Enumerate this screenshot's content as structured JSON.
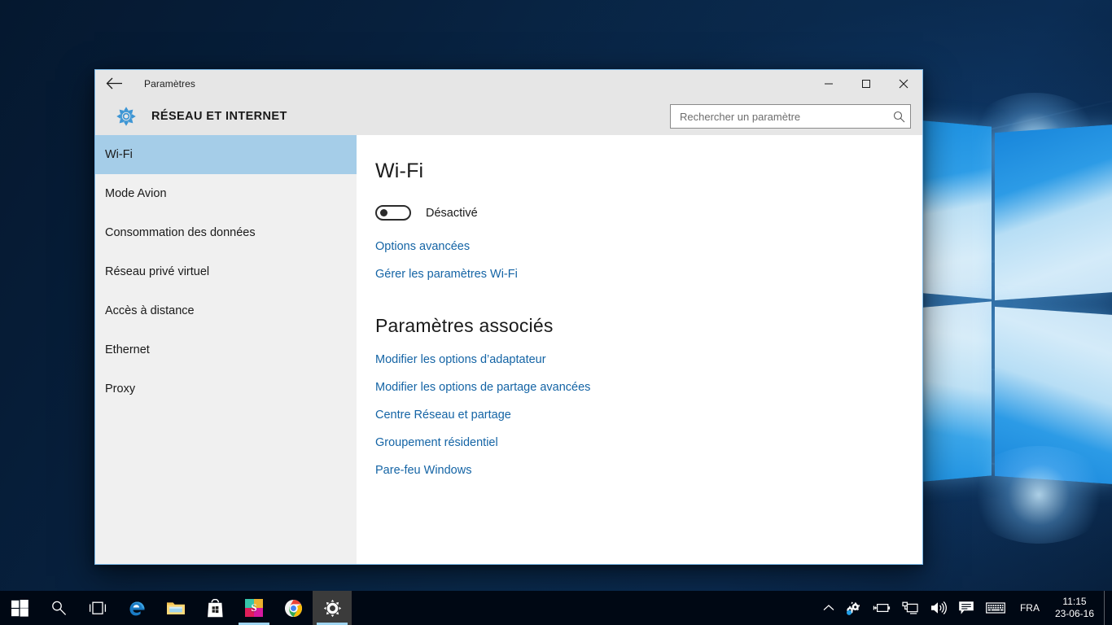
{
  "window": {
    "titlebar": {
      "back_icon": "back-arrow-icon",
      "title": "Paramètres",
      "minimize_icon": "minimize-icon",
      "maximize_icon": "maximize-icon",
      "close_icon": "close-icon"
    },
    "header": {
      "gear_icon": "gear-icon",
      "title": "RÉSEAU ET INTERNET"
    },
    "search": {
      "placeholder": "Rechercher un paramètre",
      "value": "",
      "icon": "search-icon"
    }
  },
  "sidebar": {
    "items": [
      {
        "label": "Wi-Fi",
        "selected": true
      },
      {
        "label": "Mode Avion",
        "selected": false
      },
      {
        "label": "Consommation des données",
        "selected": false
      },
      {
        "label": "Réseau privé virtuel",
        "selected": false
      },
      {
        "label": "Accès à distance",
        "selected": false
      },
      {
        "label": "Ethernet",
        "selected": false
      },
      {
        "label": "Proxy",
        "selected": false
      }
    ]
  },
  "content": {
    "heading": "Wi-Fi",
    "toggle": {
      "state_label": "Désactivé",
      "checked": false
    },
    "wifi_links": [
      "Options avancées",
      "Gérer les paramètres Wi-Fi"
    ],
    "related": {
      "heading": "Paramètres associés",
      "links": [
        "Modifier les options d’adaptateur",
        "Modifier les options de partage avancées",
        "Centre Réseau et partage",
        "Groupement résidentiel",
        "Pare-feu Windows"
      ]
    }
  },
  "taskbar": {
    "buttons": [
      {
        "name": "start-button",
        "icon": "windows-logo-icon",
        "running": false,
        "active": false
      },
      {
        "name": "search-button",
        "icon": "search-icon",
        "running": false,
        "active": false
      },
      {
        "name": "task-view-button",
        "icon": "task-view-icon",
        "running": false,
        "active": false
      },
      {
        "name": "edge-button",
        "icon": "edge-icon",
        "running": false,
        "active": false
      },
      {
        "name": "file-explorer-button",
        "icon": "folder-icon",
        "running": false,
        "active": false
      },
      {
        "name": "store-button",
        "icon": "store-bag-icon",
        "running": false,
        "active": false
      },
      {
        "name": "slack-button",
        "icon": "slack-icon",
        "running": true,
        "active": false,
        "letter": "S"
      },
      {
        "name": "chrome-button",
        "icon": "chrome-icon",
        "running": false,
        "active": false
      },
      {
        "name": "settings-button",
        "icon": "gear-icon",
        "running": true,
        "active": true
      }
    ],
    "tray": {
      "chevron_icon": "chevron-up-icon",
      "update_icon": "settings-update-icon",
      "battery_icon": "battery-charging-icon",
      "network_icon": "ethernet-monitor-icon",
      "volume_icon": "speaker-icon",
      "action_center_icon": "action-center-icon",
      "keyboard_icon": "keyboard-icon",
      "language": "FRA",
      "time": "11:15",
      "date": "23-06-16"
    }
  },
  "colors": {
    "accent_link": "#1464a5",
    "sidebar_selected": "#a5cde8",
    "window_border": "#7cb9e8",
    "chrome_bg": "#e6e6e6",
    "taskbar_bg": "#000814"
  }
}
